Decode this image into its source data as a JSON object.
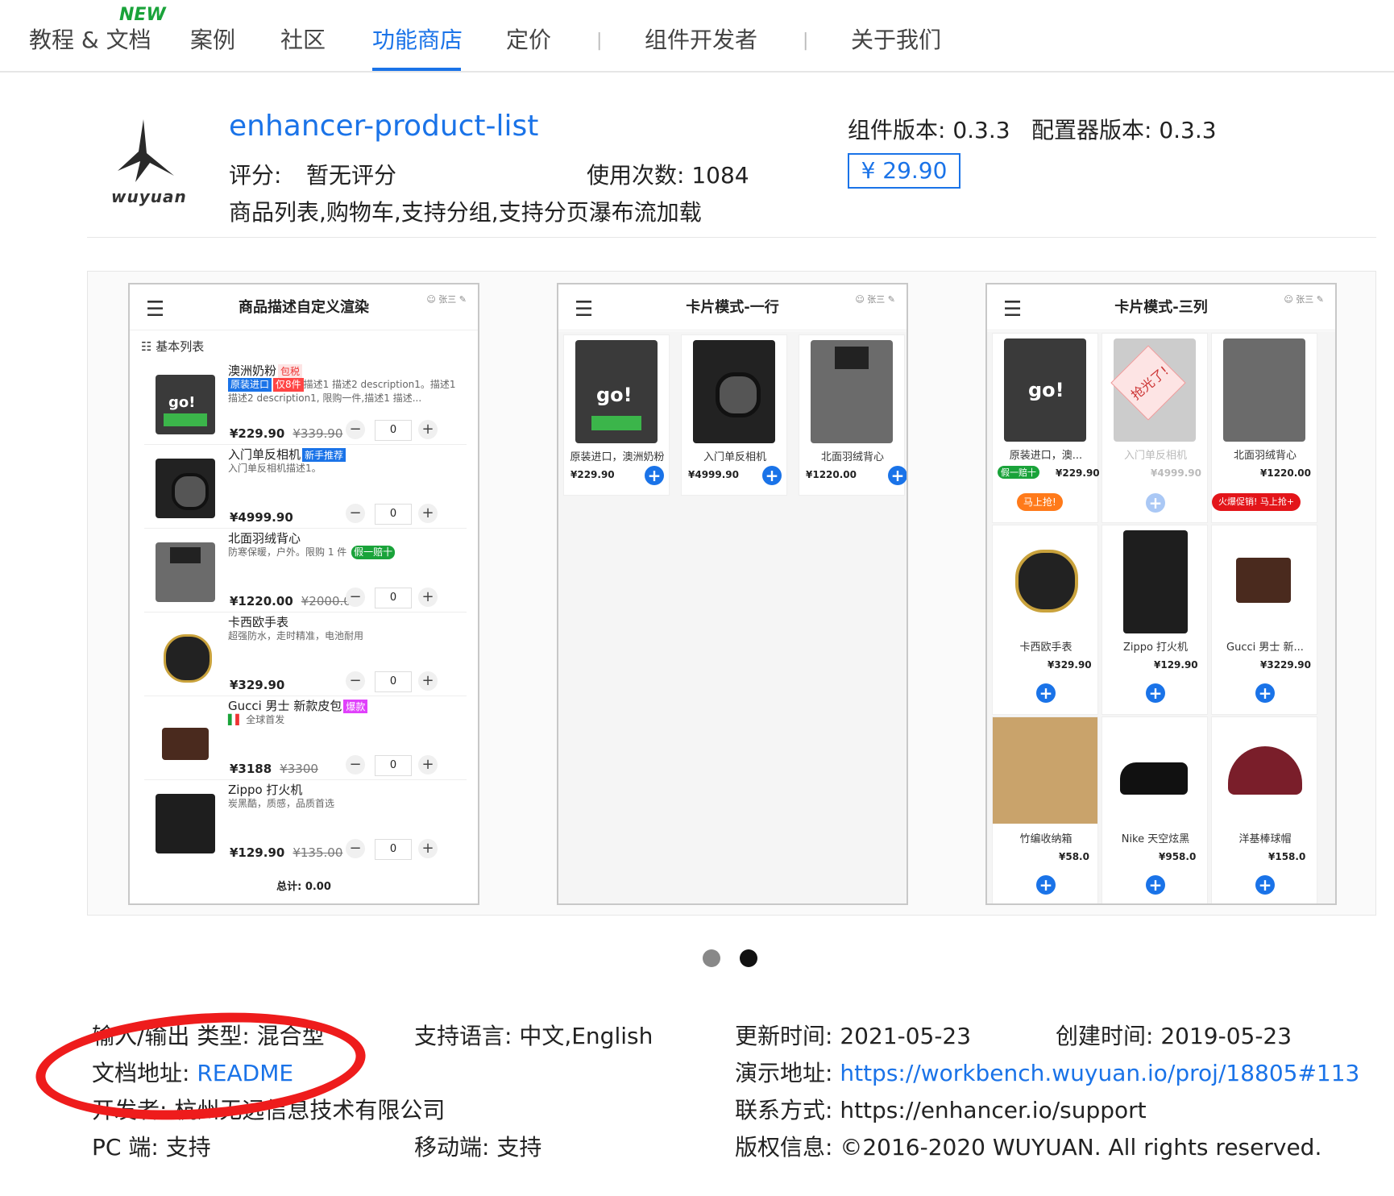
{
  "nav": {
    "items": [
      "教程 & 文档",
      "案例",
      "社区",
      "功能商店",
      "定价",
      "组件开发者",
      "关于我们"
    ],
    "active": "功能商店",
    "new_badge": "NEW",
    "separator": "|"
  },
  "product": {
    "logo_text": "wuyuan",
    "name": "enhancer-product-list",
    "rating_label": "评分:",
    "rating_value": "暂无评分",
    "usage": "使用次数: 1084",
    "description": "商品列表,购物车,支持分组,支持分页瀑布流加载",
    "component_version": "组件版本: 0.3.3",
    "configurator_version": "配置器版本: 0.3.3",
    "price": "¥ 29.90"
  },
  "phones": {
    "user": "张三",
    "phone1": {
      "title": "商品描述自定义渲染",
      "section": "基本列表",
      "total": "总计: 0.00",
      "items": [
        {
          "name": "澳洲奶粉",
          "tag1": "包税",
          "tag2": "原装进口",
          "tag3": "仅8件",
          "desc": "描述1 描述2 description1。描述1 描述2 description1, 限购一件,描述1 描述...",
          "price": "¥229.90",
          "old": "¥339.90",
          "qty": "0"
        },
        {
          "name": "入门单反相机",
          "tag1": "新手推荐",
          "desc": "入门单反相机描述1。",
          "price": "¥4999.90",
          "old": "",
          "qty": "0"
        },
        {
          "name": "北面羽绒背心",
          "tag1": "假一赔十",
          "desc": "防寒保暖，户外。限购 1 件",
          "price": "¥1220.00",
          "old": "¥2000.00",
          "qty": "0"
        },
        {
          "name": "卡西欧手表",
          "desc": "超强防水，走时精准，电池耐用",
          "price": "¥329.90",
          "old": "",
          "qty": "0"
        },
        {
          "name": "Gucci 男士 新款皮包",
          "tag1": "爆款",
          "desc": "全球首发",
          "price": "¥3188",
          "old": "¥3300",
          "qty": "0"
        },
        {
          "name": "Zippo 打火机",
          "desc": "炭黑酷，质感，品质首选",
          "price": "¥129.90",
          "old": "¥135.00",
          "qty": "0"
        }
      ]
    },
    "phone2": {
      "title": "卡片模式-一行",
      "cards": [
        {
          "name": "原装进口，澳洲奶粉",
          "price": "¥229.90"
        },
        {
          "name": "入门单反相机",
          "price": "¥4999.90"
        },
        {
          "name": "北面羽绒背心",
          "price": "¥1220.00"
        }
      ]
    },
    "phone3": {
      "title": "卡片模式-三列",
      "sold_out": "抢光了!",
      "buy_now": "马上抢!",
      "flash_sale": "火爆促销! 马上抢+",
      "guarantee": "假一赔十",
      "cards": [
        {
          "name": "原装进口，澳...",
          "price": "¥229.90"
        },
        {
          "name": "入门单反相机",
          "price": "¥4999.90"
        },
        {
          "name": "北面羽绒背心",
          "price": "¥1220.00"
        },
        {
          "name": "卡西欧手表",
          "price": "¥329.90"
        },
        {
          "name": "Zippo 打火机",
          "price": "¥129.90"
        },
        {
          "name": "Gucci 男士 新...",
          "price": "¥3229.90"
        },
        {
          "name": "竹编收纳箱",
          "price": "¥58.0"
        },
        {
          "name": "Nike 天空炫黑",
          "price": "¥958.0"
        },
        {
          "name": "洋基棒球帽",
          "price": "¥158.0"
        }
      ]
    }
  },
  "carousel": {
    "active_dot": 2,
    "dot_count": 2
  },
  "info": {
    "io_type": "输入/输出 类型: 混合型",
    "languages": "支持语言: 中文,English",
    "updated": "更新时间: 2021-05-23",
    "created": "创建时间: 2019-05-23",
    "doc_label": "文档地址:",
    "doc_link": "README",
    "demo_label": "演示地址:",
    "demo_link": "https://workbench.wuyuan.io/proj/18805#113",
    "developer": "开发者: 杭州无远信息技术有限公司",
    "contact": "联系方式: https://enhancer.io/support",
    "pc": "PC 端: 支持",
    "mobile": "移动端: 支持",
    "copyright": "版权信息: ©2016-2020 WUYUAN. All rights reserved."
  },
  "colors": {
    "accent": "#1a73e8",
    "annotation": "#ee1c1c"
  }
}
